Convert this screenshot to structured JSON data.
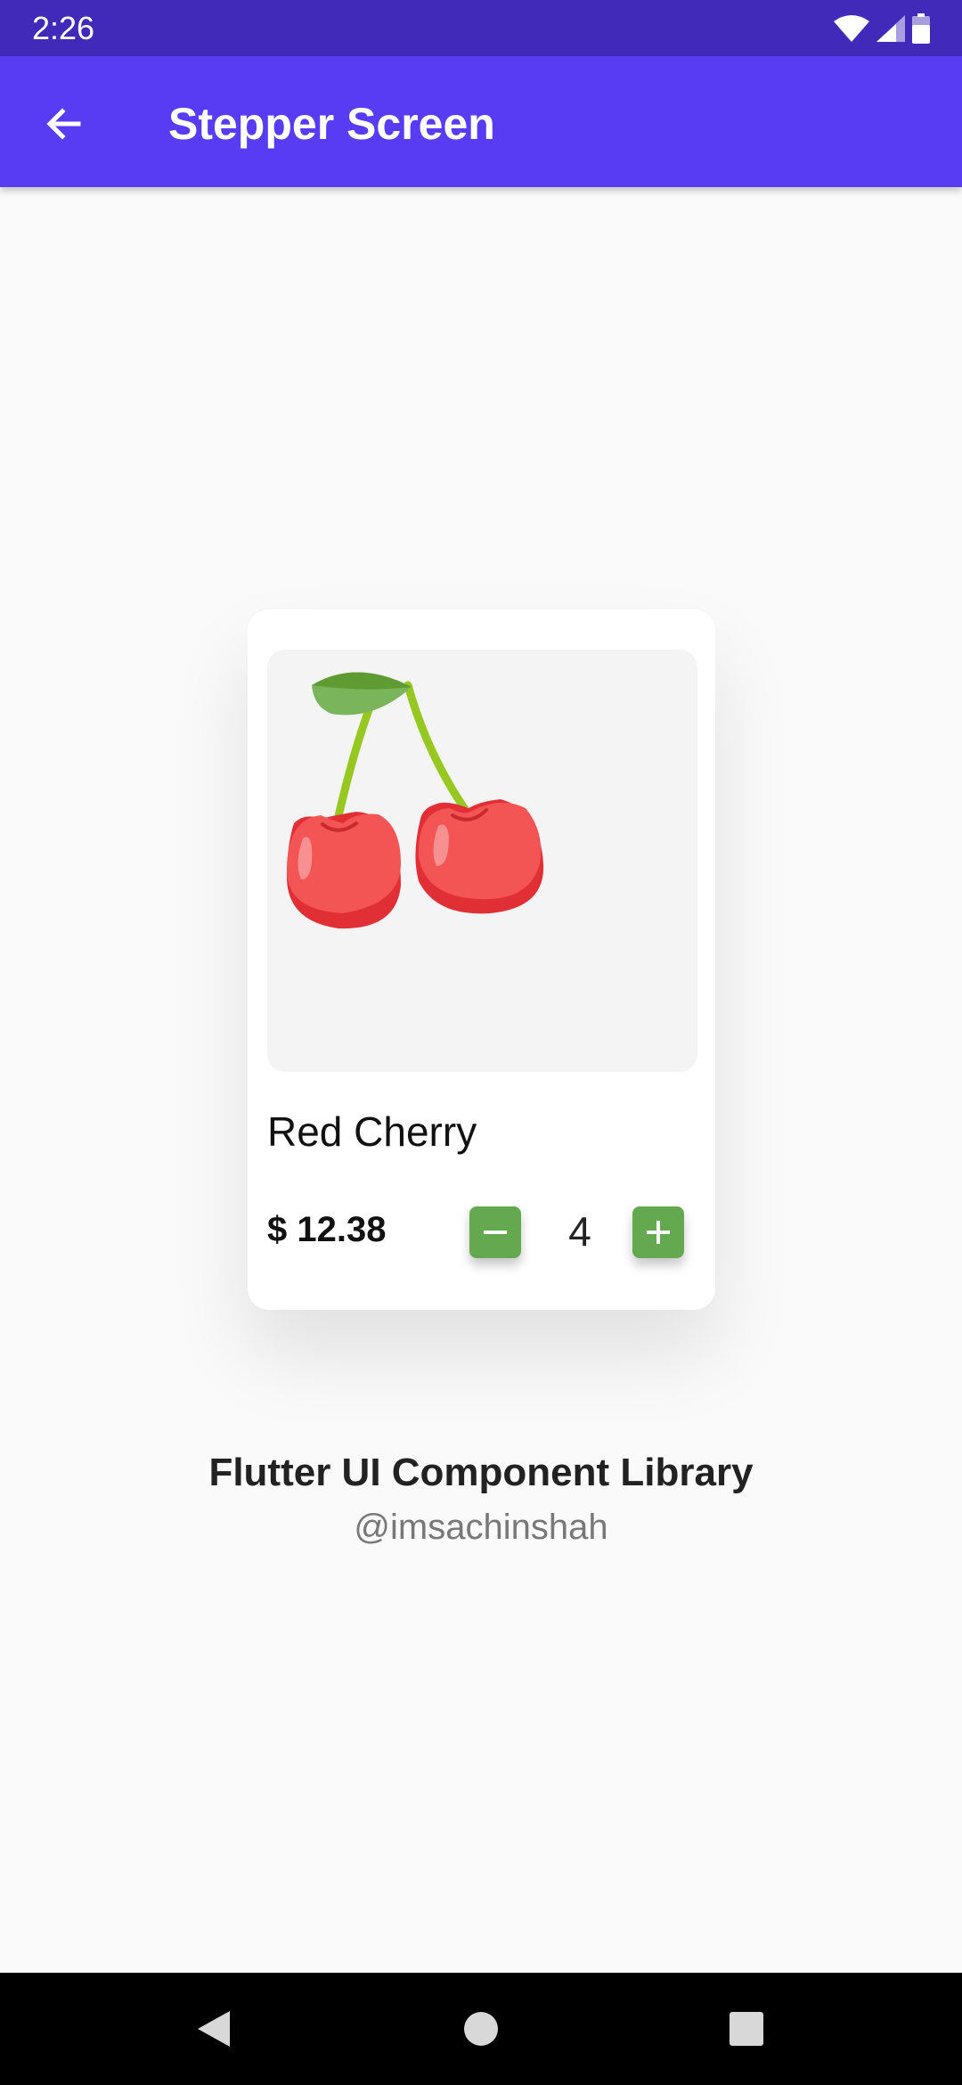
{
  "status_bar": {
    "time": "2:26",
    "icons": [
      "wifi-icon",
      "signal-icon",
      "battery-icon"
    ]
  },
  "app_bar": {
    "title": "Stepper Screen",
    "back_icon": "arrow-back-icon"
  },
  "product": {
    "image": "cherry-image",
    "name": "Red Cherry",
    "price": "$ 12.38",
    "quantity": "4",
    "decrement_icon": "minus-icon",
    "increment_icon": "plus-icon"
  },
  "footer": {
    "title": "Flutter UI Component Library",
    "handle": "@imsachinshah"
  },
  "nav_bar": {
    "icons": [
      "nav-back-icon",
      "nav-home-icon",
      "nav-recents-icon"
    ]
  },
  "colors": {
    "status_bar": "#4129b9",
    "app_bar": "#583cf4",
    "accent_green": "#64a84f",
    "background": "#fafafa"
  }
}
